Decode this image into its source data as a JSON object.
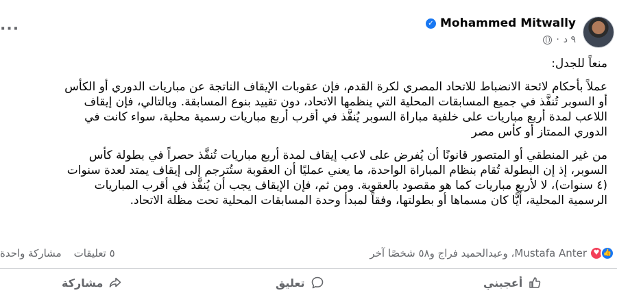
{
  "post": {
    "author": "Mohammed Mitwally",
    "time": "٩ د",
    "body_lines": [
      "منعاً للجدل:",
      "عملاً بأحكام لائحة الانضباط للاتحاد المصري لكرة القدم، فإن عقوبات الإيقاف الناتجة عن مباريات الدوري أو الكأس",
      "أو السوبر تُنفَّذ في جميع المسابقات المحلية التي ينظمها الاتحاد، دون تقييد بنوع المسابقة. وبالتالي، فإن إيقاف",
      "اللاعب لمدة أربع مباريات على خلفية مباراة السوبر يُنفَّذ في أقرب أربع مباريات رسمية محلية، سواء كانت في",
      "الدوري الممتاز أو كأس مصر",
      "من غير المنطقي أو المتصور قانونًا أن يُفرض على لاعب إيقاف لمدة أربع مباريات تُنفَّذ حصراً في بطولة كأس",
      "السوبر، إذ إن البطولة تُقام بنظام المباراة الواحدة، ما يعني عمليًا أن العقوبة ستُترجم إلى إيقاف يمتد لعدة سنوات",
      "(٤ سنوات)، لا لأربع مباريات كما هو مقصود بالعقوبة. ومن ثم، فإن الإيقاف يجب أن يُنفَّذ في أقرب المباريات",
      "الرسمية المحلية، أيًّا كان مسماها أو بطولتها، وفقاً لمبدأ وحدة المسابقات المحلية تحت مظلة الاتحاد."
    ]
  },
  "reactions": {
    "reactors_text": "Mustafa Anter، وعبدالحميد فراج و٥٨ شخصًا آخر",
    "comments_count": "٥ تعليقات",
    "shares_count": "مشاركة واحدة"
  },
  "actions": {
    "like_label": "أعجبني",
    "comment_label": "تعليق",
    "share_label": "مشاركة"
  }
}
